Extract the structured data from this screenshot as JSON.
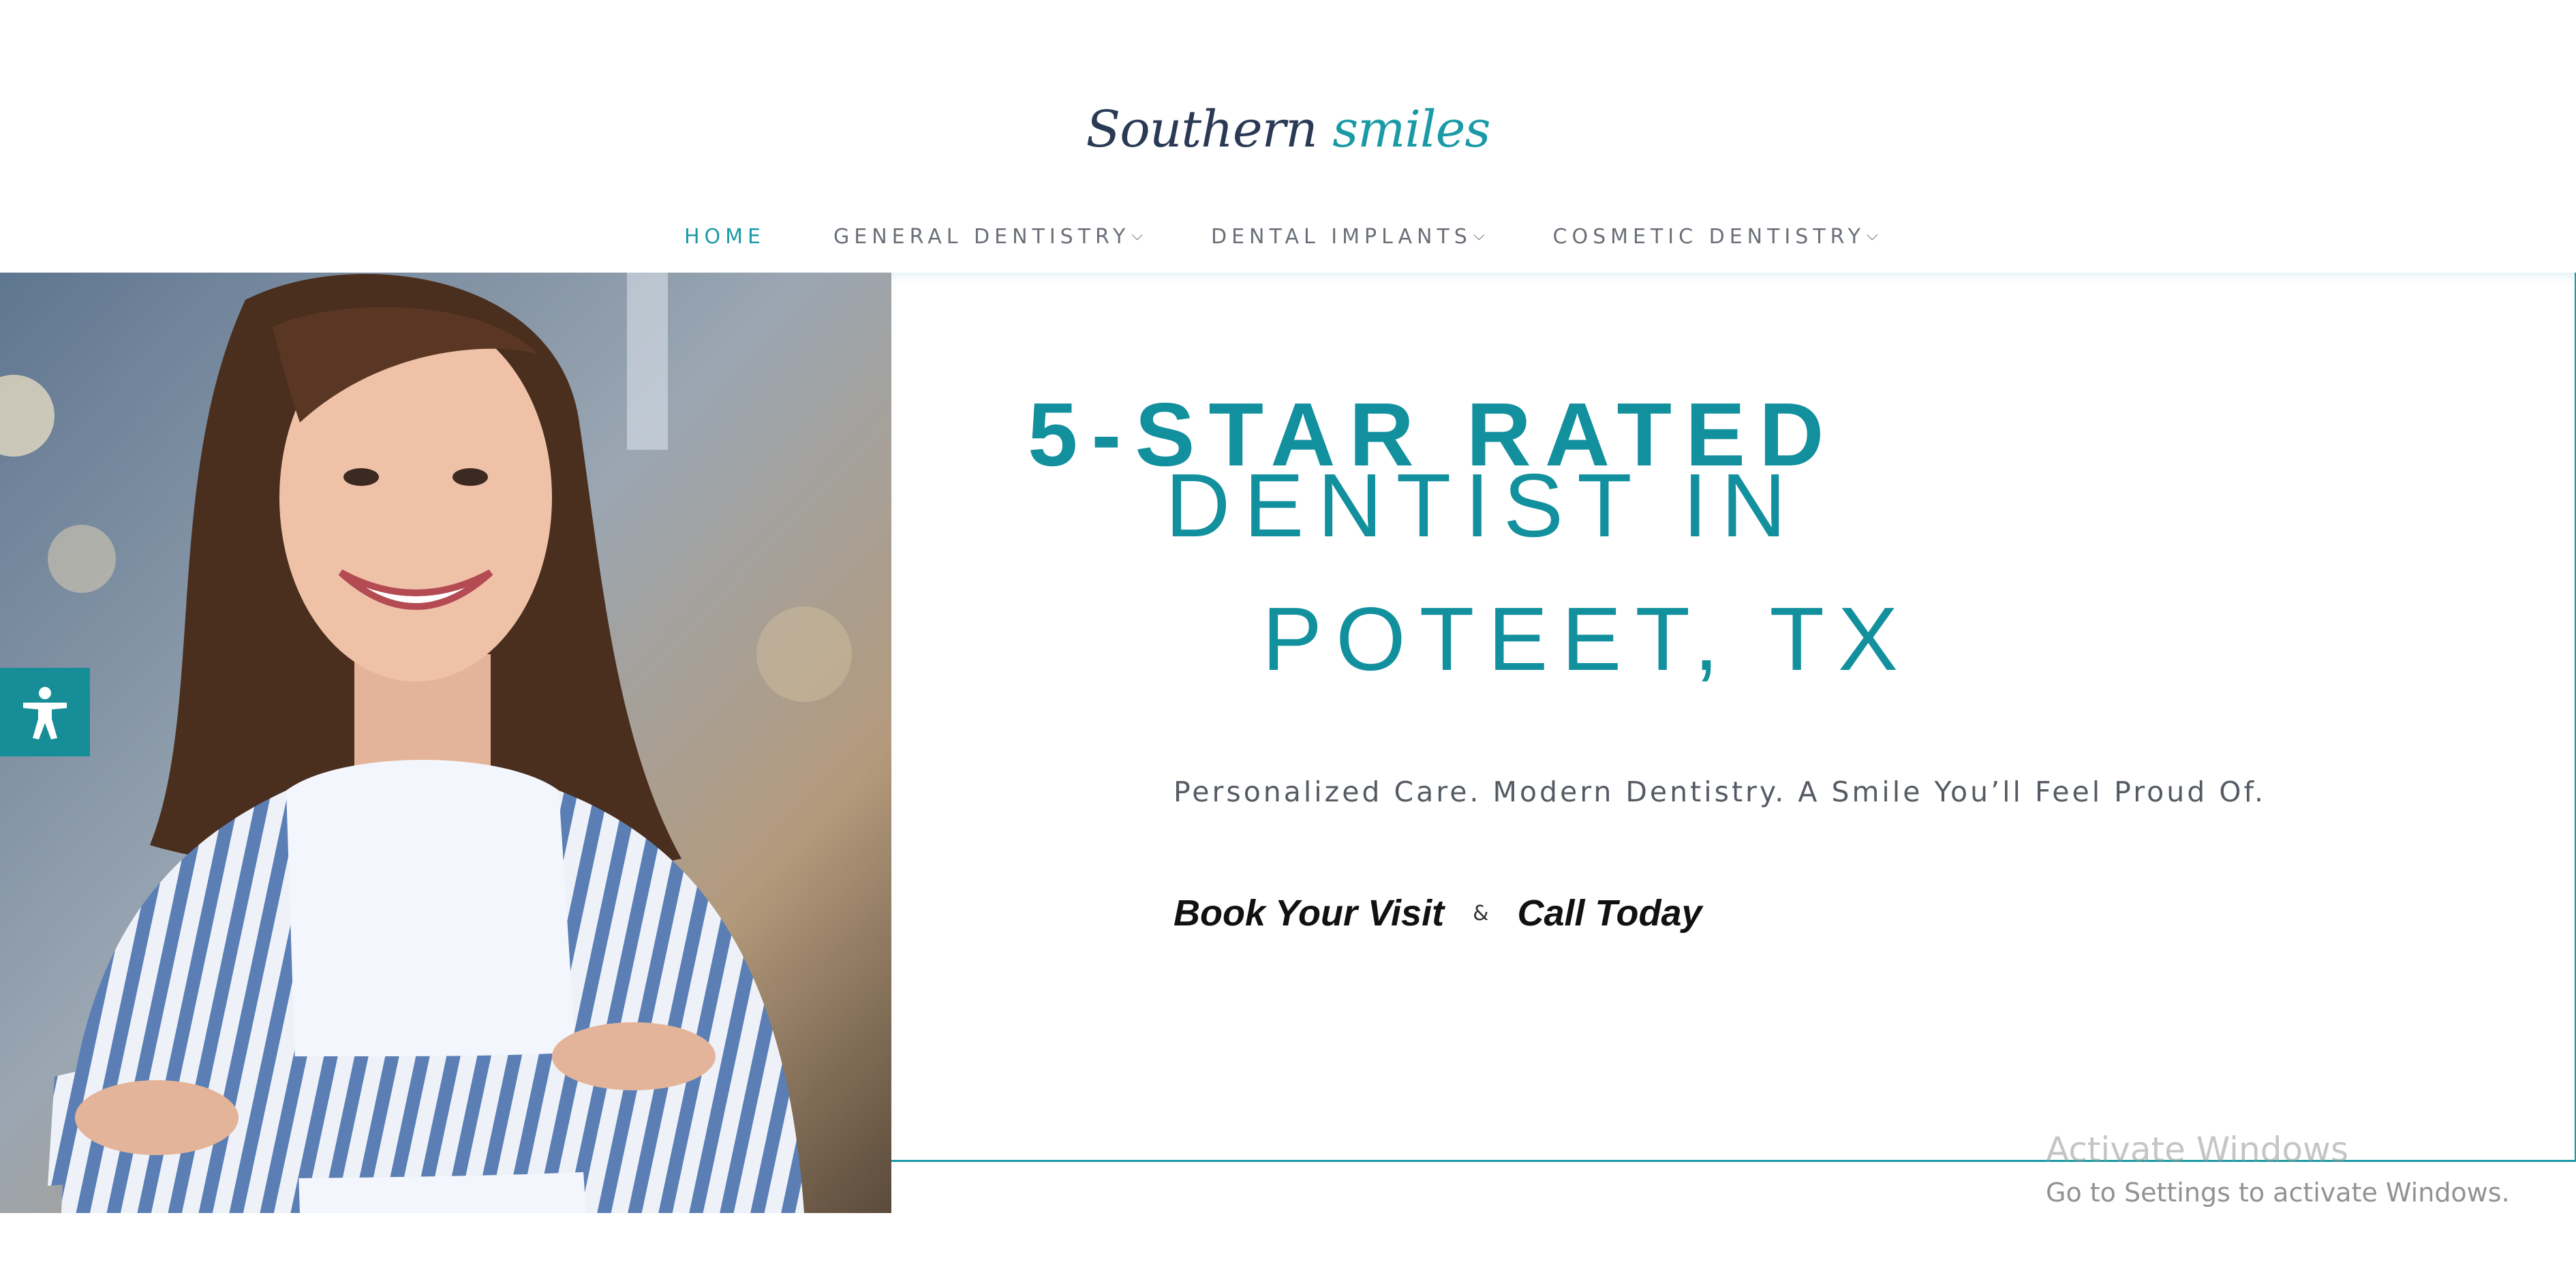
{
  "header": {
    "logo": {
      "word1": "Southern",
      "word2": "smiles"
    },
    "nav": [
      {
        "label": "HOME"
      },
      {
        "label": "GENERAL DENTISTRY"
      },
      {
        "label": "DENTAL IMPLANTS"
      },
      {
        "label": "COSMETIC DENTISTRY"
      }
    ]
  },
  "hero": {
    "headline": {
      "line1": "5-STAR RATED",
      "line2": "DENTIST IN",
      "line3": "POTEET, TX"
    },
    "tagline": "Personalized Care. Modern Dentistry. A Smile You’ll Feel Proud Of.",
    "cta": {
      "book_label": "Book Your Visit",
      "separator": "&",
      "call_label": "Call Today"
    }
  },
  "accessibility": {
    "icon": "accessibility-person-icon"
  },
  "watermark": {
    "title": "Activate Windows",
    "subtitle": "Go to Settings to activate Windows."
  },
  "colors": {
    "accent": "#1a9aa6",
    "headline": "#13909e",
    "logo_dark": "#2a3a55",
    "nav_text": "#6a6f78",
    "accessibility_bg": "#178d97"
  }
}
